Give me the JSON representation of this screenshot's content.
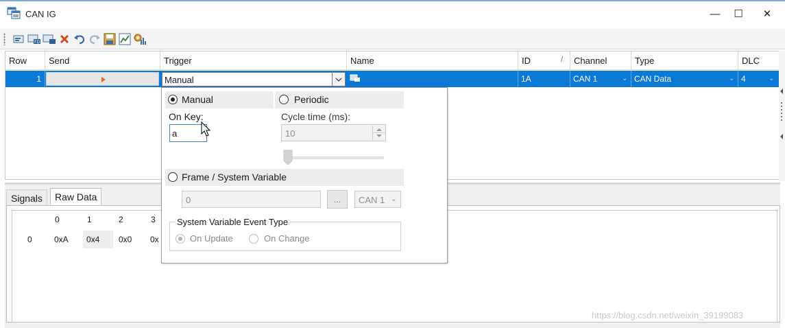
{
  "window": {
    "title": "CAN IG",
    "minimize_glyph": "—",
    "maximize_glyph": "☐",
    "close_glyph": "✕"
  },
  "toolbar": {
    "buttons": [
      {
        "name": "add-message-icon"
      },
      {
        "name": "add-fd-message-icon"
      },
      {
        "name": "add-message-2-icon"
      },
      {
        "name": "delete-icon"
      },
      {
        "name": "undo-icon"
      },
      {
        "name": "redo-icon"
      },
      {
        "name": "save-icon"
      },
      {
        "name": "chart-icon"
      },
      {
        "name": "settings-icon"
      }
    ]
  },
  "grid": {
    "headers": {
      "row": "Row",
      "send": "Send",
      "trigger": "Trigger",
      "name": "Name",
      "id": "ID",
      "id_sort": "/",
      "channel": "Channel",
      "type": "Type",
      "dlc": "DLC"
    },
    "row": {
      "number": "1",
      "trigger": "Manual",
      "id": "1A",
      "channel": "CAN 1",
      "type": "CAN Data",
      "dlc": "4"
    }
  },
  "popup": {
    "manual_label": "Manual",
    "manual_selected": true,
    "periodic_label": "Periodic",
    "periodic_selected": false,
    "on_key_label": "On Key:",
    "on_key_value": "a",
    "cycle_time_label": "Cycle time (ms):",
    "cycle_time_value": "10",
    "frame_label": "Frame / System Variable",
    "frame_value": "0",
    "browse_label": "...",
    "channel_value": "CAN 1",
    "sysvar_group_label": "System Variable Event Type",
    "on_update_label": "On Update",
    "on_change_label": "On Change"
  },
  "tabs": {
    "signals": "Signals",
    "raw": "Raw Data"
  },
  "raw": {
    "headers": [
      "0",
      "1",
      "2",
      "3"
    ],
    "row_label": "0",
    "values": [
      "0xA",
      "0x4",
      "0x0",
      "0x"
    ]
  },
  "watermark": "https://blog.csdn.net/weixin_39199083",
  "colors": {
    "selection": "#0a7ad6",
    "title_accent": "#7fa9cf"
  }
}
